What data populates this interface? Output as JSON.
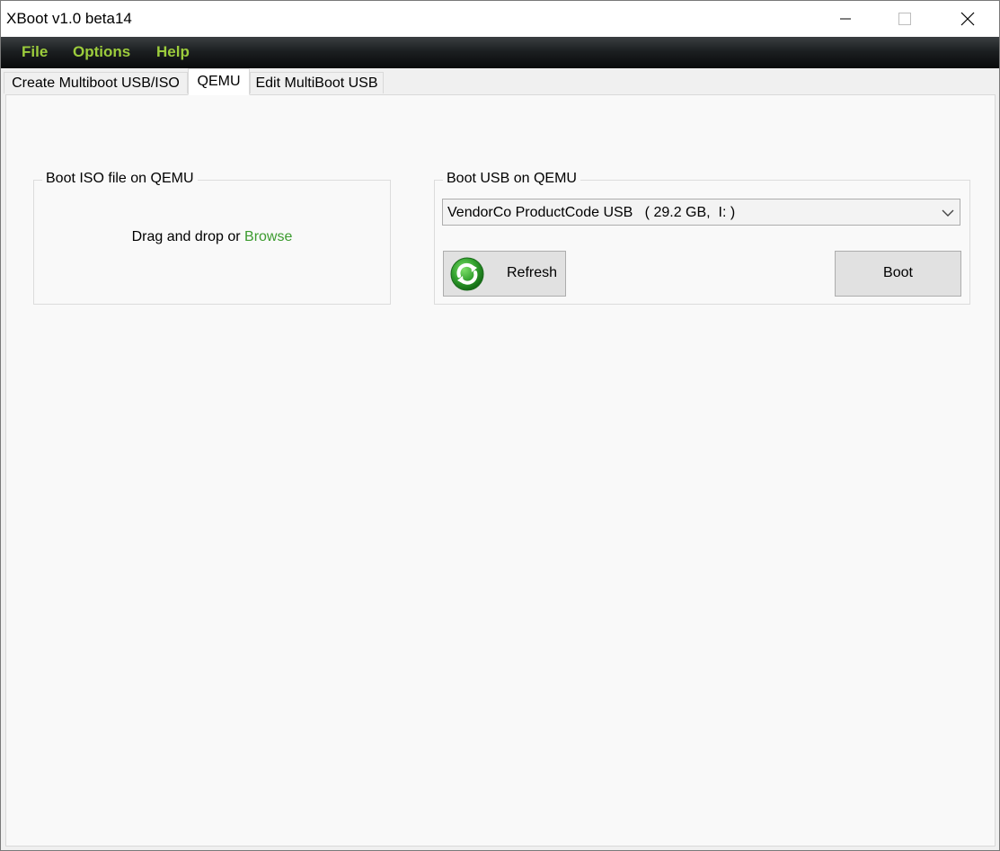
{
  "window": {
    "title": "XBoot v1.0 beta14"
  },
  "colors": {
    "menu_text": "#9ccc3c",
    "link": "#3c9b2f",
    "refresh_icon": "#2f9e2c"
  },
  "menu": {
    "items": [
      {
        "label": "File"
      },
      {
        "label": "Options"
      },
      {
        "label": "Help"
      }
    ]
  },
  "tabs": [
    {
      "label": "Create Multiboot USB/ISO",
      "active": false
    },
    {
      "label": "QEMU",
      "active": true
    },
    {
      "label": "Edit MultiBoot USB",
      "active": false
    }
  ],
  "qemu": {
    "iso_group": {
      "legend": "Boot ISO file on QEMU",
      "drop_text": "Drag and drop or ",
      "browse_label": "Browse"
    },
    "usb_group": {
      "legend": "Boot USB on QEMU",
      "selected_device": "VendorCo ProductCode USB   ( 29.2 GB,  I: )",
      "refresh_label": "Refresh",
      "boot_label": "Boot"
    }
  },
  "icons": {
    "minimize": "minimize-icon",
    "maximize": "maximize-icon",
    "close": "close-icon",
    "refresh": "refresh-icon",
    "dropdown": "chevron-down-icon"
  }
}
